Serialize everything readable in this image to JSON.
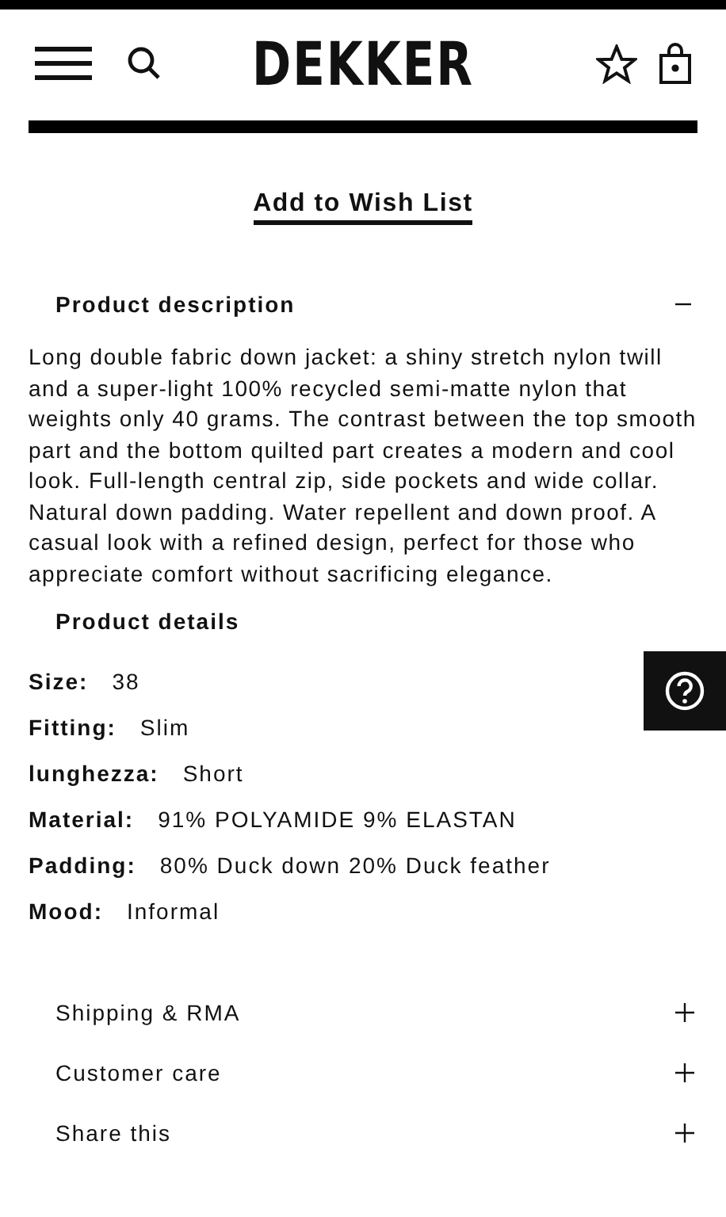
{
  "header": {
    "logo": "DEKKER"
  },
  "wishlist_link": "Add to Wish List",
  "description": {
    "title": "Product description",
    "expanded": true,
    "text": "Long double fabric down jacket: a shiny stretch nylon twill and a super-light 100% recycled semi-matte nylon that weights only 40 grams. The contrast between the top smooth part and the bottom quilted part creates a modern and cool look. Full-length central zip, side pockets and wide collar. Natural down padding. Water repellent and down proof. A casual look with a refined design, perfect for those who appreciate comfort without sacrificing elegance."
  },
  "details": {
    "title": "Product details",
    "rows": [
      {
        "label": "Size:",
        "value": "38"
      },
      {
        "label": "Fitting:",
        "value": "Slim"
      },
      {
        "label": "lunghezza:",
        "value": "Short"
      },
      {
        "label": "Material:",
        "value": "91% POLYAMIDE 9% ELASTAN"
      },
      {
        "label": "Padding:",
        "value": "80% Duck down 20% Duck feather"
      },
      {
        "label": "Mood:",
        "value": "Informal"
      }
    ]
  },
  "accordions": [
    {
      "title": "Shipping & RMA",
      "expanded": false
    },
    {
      "title": "Customer care",
      "expanded": false
    },
    {
      "title": "Share this",
      "expanded": false
    }
  ]
}
